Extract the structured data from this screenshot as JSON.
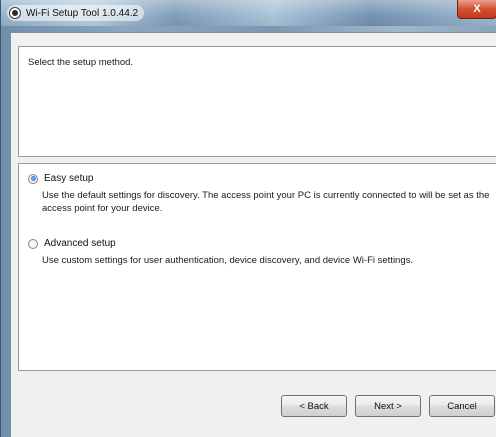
{
  "window": {
    "title": "Wi-Fi Setup Tool 1.0.44.2",
    "close_label": "X",
    "app_icon": "app-icon",
    "close_icon": "close-icon"
  },
  "instruction": "Select the setup method.",
  "options": [
    {
      "label": "Easy setup",
      "selected": true,
      "description": "Use the default settings for discovery. The access point your PC is currently connected to will be set as the access point for your device."
    },
    {
      "label": "Advanced setup",
      "selected": false,
      "description": "Use custom settings for user authentication, device discovery, and device Wi-Fi settings."
    }
  ],
  "buttons": {
    "back": "< Back",
    "next": "Next >",
    "cancel": "Cancel"
  },
  "colors": {
    "title_glass": "#8fb0cb",
    "client_bg": "#f0f0f0",
    "close": "#c23a1b",
    "radio_accent": "#1f6fcf"
  }
}
